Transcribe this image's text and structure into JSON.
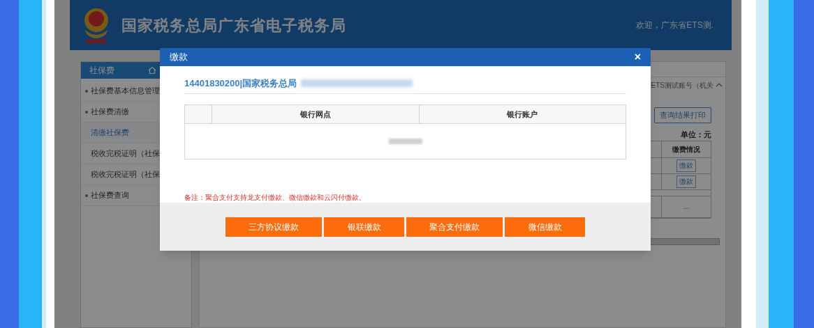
{
  "header": {
    "title": "国家税务总局广东省电子税务局",
    "welcome": "欢迎，广东省ETS测."
  },
  "sidebar": {
    "title": "社保费",
    "items": [
      {
        "label": "社保费基本信息管理",
        "kind": "group",
        "selected": false
      },
      {
        "label": "社保费清缴",
        "kind": "group",
        "selected": false
      },
      {
        "label": "清缴社保费",
        "kind": "sub",
        "selected": true
      },
      {
        "label": "税收完税证明（社保",
        "kind": "sub",
        "selected": false
      },
      {
        "label": "税收完税证明（社保",
        "kind": "sub",
        "selected": false
      },
      {
        "label": "社保费查询",
        "kind": "group",
        "selected": false
      }
    ]
  },
  "content": {
    "account": "ETS测试账号（机关",
    "print_button": "查询结果打印",
    "unit": "单位：元",
    "table": {
      "column": "缴费情况",
      "rows": [
        {
          "cell": "缴款",
          "kind": "button"
        },
        {
          "cell": "缴款",
          "kind": "button"
        },
        {
          "cell": "...",
          "kind": "text"
        }
      ]
    }
  },
  "dialog": {
    "title": "缴款",
    "close": "×",
    "taxpayer": "14401830200|国家税务总局",
    "table": {
      "columns": [
        "银行网点",
        "银行账户"
      ]
    },
    "note": "备注：聚合支付支持龙支付缴款、微信缴款和云闪付缴款。",
    "buttons": [
      "三方协议缴款",
      "银联缴款",
      "聚合支付缴款",
      "微信缴款"
    ]
  }
}
